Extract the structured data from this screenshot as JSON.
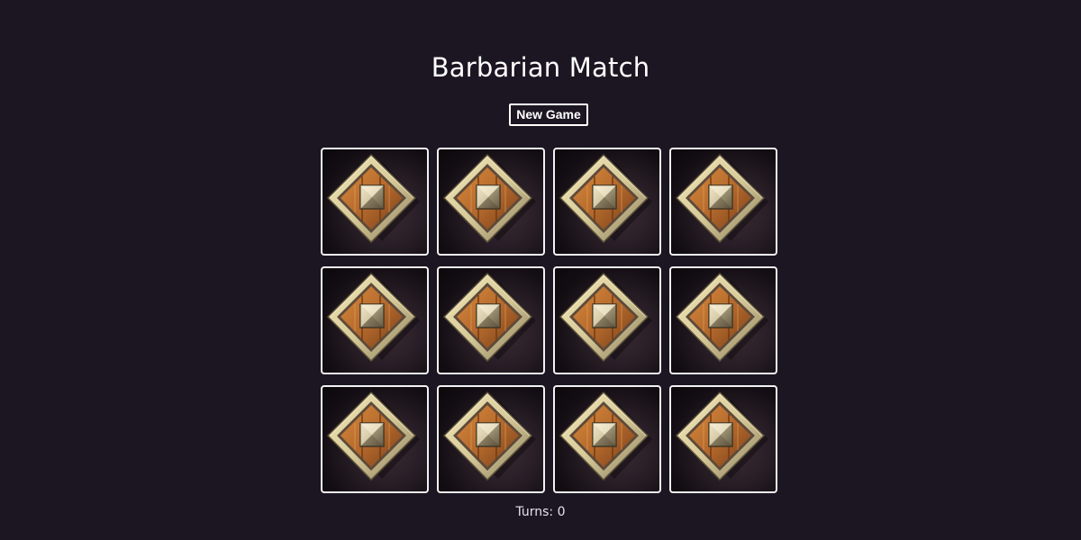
{
  "title": "Barbarian Match",
  "new_game_label": "New Game",
  "turns_label": "Turns:",
  "turns_value": "0",
  "cards": [
    {
      "state": "face-down",
      "icon": "shield-card-back-icon"
    },
    {
      "state": "face-down",
      "icon": "shield-card-back-icon"
    },
    {
      "state": "face-down",
      "icon": "shield-card-back-icon"
    },
    {
      "state": "face-down",
      "icon": "shield-card-back-icon"
    },
    {
      "state": "face-down",
      "icon": "shield-card-back-icon"
    },
    {
      "state": "face-down",
      "icon": "shield-card-back-icon"
    },
    {
      "state": "face-down",
      "icon": "shield-card-back-icon"
    },
    {
      "state": "face-down",
      "icon": "shield-card-back-icon"
    },
    {
      "state": "face-down",
      "icon": "shield-card-back-icon"
    },
    {
      "state": "face-down",
      "icon": "shield-card-back-icon"
    },
    {
      "state": "face-down",
      "icon": "shield-card-back-icon"
    },
    {
      "state": "face-down",
      "icon": "shield-card-back-icon"
    }
  ],
  "colors": {
    "background": "#1b1622",
    "text": "#ffffff",
    "card_border": "#f2f2f2",
    "shield_wood": "#b56a2d",
    "shield_rim": "#d8cb9a",
    "boss_metal": "#cfc3a0"
  }
}
